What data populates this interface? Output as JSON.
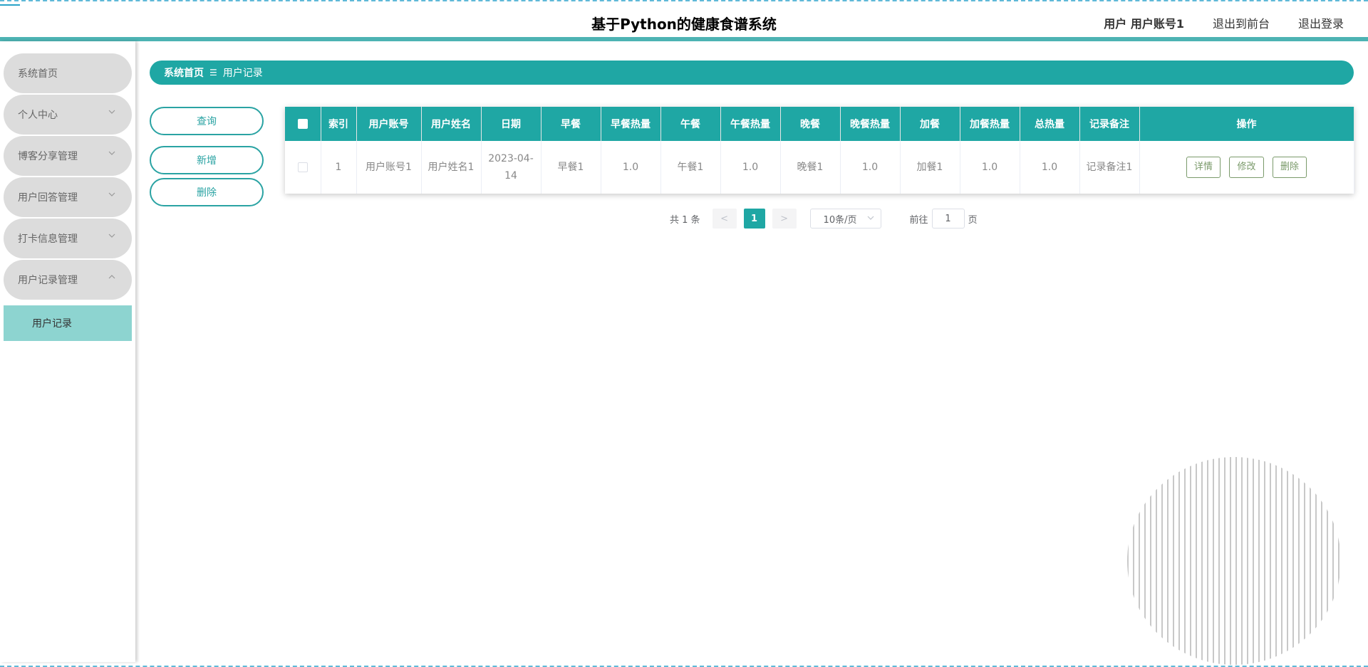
{
  "header": {
    "title": "基于Python的健康食谱系统",
    "user_label": "用户 用户账号1",
    "front_link": "退出到前台",
    "logout_link": "退出登录"
  },
  "sidebar": {
    "items": [
      {
        "label": "系统首页",
        "has_chevron": false
      },
      {
        "label": "个人中心",
        "has_chevron": true
      },
      {
        "label": "博客分享管理",
        "has_chevron": true
      },
      {
        "label": "用户回答管理",
        "has_chevron": true
      },
      {
        "label": "打卡信息管理",
        "has_chevron": true
      },
      {
        "label": "用户记录管理",
        "has_chevron": true,
        "expanded": true
      }
    ],
    "submenu": {
      "label": "用户记录"
    }
  },
  "breadcrumb": {
    "home": "系统首页",
    "separator": "☰",
    "current": "用户记录"
  },
  "actions": {
    "query": "查询",
    "add": "新增",
    "delete": "删除"
  },
  "table": {
    "headers": [
      "索引",
      "用户账号",
      "用户姓名",
      "日期",
      "早餐",
      "早餐热量",
      "午餐",
      "午餐热量",
      "晚餐",
      "晚餐热量",
      "加餐",
      "加餐热量",
      "总热量",
      "记录备注",
      "操作"
    ],
    "rows": [
      {
        "index": "1",
        "account": "用户账号1",
        "name": "用户姓名1",
        "date": "2023-04-14",
        "breakfast": "早餐1",
        "breakfast_cal": "1.0",
        "lunch": "午餐1",
        "lunch_cal": "1.0",
        "dinner": "晚餐1",
        "dinner_cal": "1.0",
        "snack": "加餐1",
        "snack_cal": "1.0",
        "total_cal": "1.0",
        "note": "记录备注1",
        "ops": {
          "detail": "详情",
          "edit": "修改",
          "delete": "删除"
        }
      }
    ]
  },
  "pagination": {
    "total_text": "共 1 条",
    "prev": "<",
    "current_page": "1",
    "next": ">",
    "page_size": "10条/页",
    "goto_label": "前往",
    "goto_value": "1",
    "page_suffix": "页"
  },
  "colors": {
    "accent": "#1fa7a4",
    "menu_bg": "#dcdcdc",
    "submenu_bg": "#8dd4d0",
    "header_bar": "#4db3b3"
  }
}
